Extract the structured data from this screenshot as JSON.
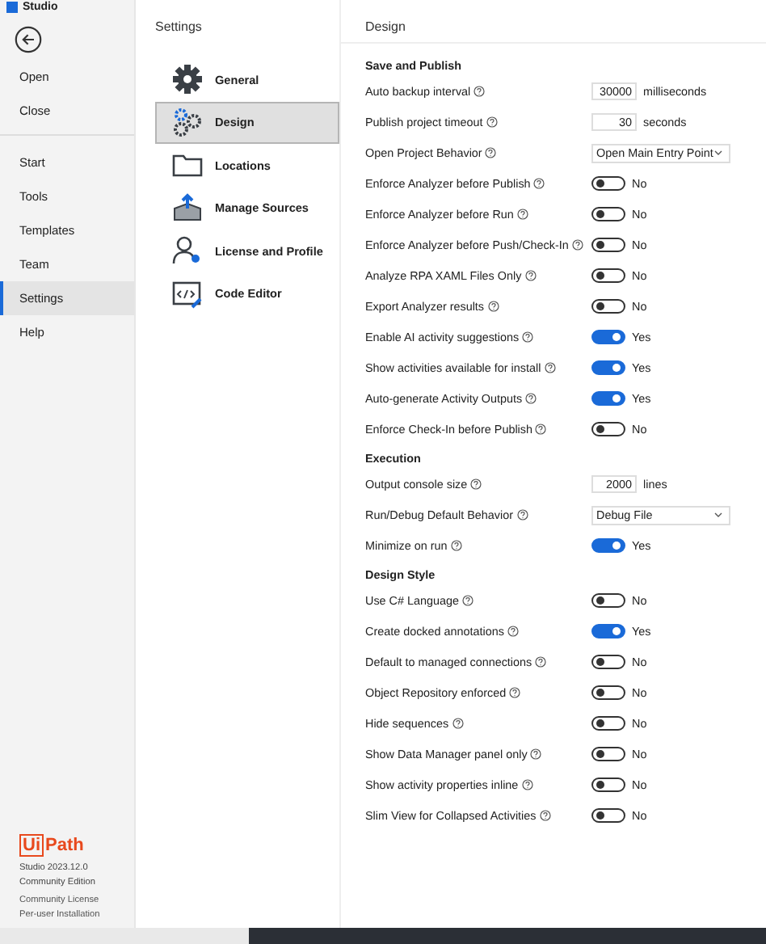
{
  "window": {
    "title": "Studio"
  },
  "sidebar": {
    "file_items": [
      {
        "label": "Open",
        "selected": false
      },
      {
        "label": "Close",
        "selected": false
      }
    ],
    "items": [
      {
        "label": "Start",
        "selected": false
      },
      {
        "label": "Tools",
        "selected": false
      },
      {
        "label": "Templates",
        "selected": false
      },
      {
        "label": "Team",
        "selected": false
      },
      {
        "label": "Settings",
        "selected": true
      },
      {
        "label": "Help",
        "selected": false
      }
    ],
    "logo": {
      "part_1": "Ui",
      "part_2": "Path"
    },
    "version": [
      "Studio 2023.12.0",
      "Community Edition"
    ],
    "license": [
      "Community License",
      "Per-user Installation"
    ]
  },
  "settings_nav": {
    "title": "Settings",
    "items": [
      {
        "label": "General",
        "kind": "gear",
        "selected": false
      },
      {
        "label": "Design",
        "kind": "gears",
        "selected": true
      },
      {
        "label": "Locations",
        "kind": "folder",
        "selected": false
      },
      {
        "label": "Manage Sources",
        "kind": "box",
        "selected": false
      },
      {
        "label": "License and Profile",
        "kind": "user",
        "selected": false
      },
      {
        "label": "Code Editor",
        "kind": "code",
        "selected": false
      }
    ]
  },
  "design": {
    "title": "Design",
    "sections": [
      {
        "title": "Save and Publish",
        "rows": [
          {
            "label": "Auto backup interval",
            "kind": "number",
            "value": "30000",
            "unit": "milliseconds"
          },
          {
            "label": "Publish project timeout",
            "kind": "number",
            "value": "30",
            "unit": "seconds"
          },
          {
            "label": "Open Project Behavior",
            "kind": "dropdown",
            "value": "Open Main Entry Point"
          },
          {
            "label": "Enforce Analyzer before Publish",
            "kind": "toggle",
            "on": false,
            "state_text": "No"
          },
          {
            "label": "Enforce Analyzer before Run",
            "kind": "toggle",
            "on": false,
            "state_text": "No"
          },
          {
            "label": "Enforce Analyzer before Push/Check-In",
            "kind": "toggle",
            "on": false,
            "state_text": "No"
          },
          {
            "label": "Analyze RPA XAML Files Only",
            "kind": "toggle",
            "on": false,
            "state_text": "No"
          },
          {
            "label": "Export Analyzer results",
            "kind": "toggle",
            "on": false,
            "state_text": "No"
          },
          {
            "label": "Enable AI activity suggestions",
            "kind": "toggle",
            "on": true,
            "state_text": "Yes"
          },
          {
            "label": "Show activities available for install",
            "kind": "toggle",
            "on": true,
            "state_text": "Yes"
          },
          {
            "label": "Auto-generate Activity Outputs",
            "kind": "toggle",
            "on": true,
            "state_text": "Yes"
          },
          {
            "label": "Enforce Check-In before Publish",
            "kind": "toggle",
            "on": false,
            "state_text": "No"
          }
        ]
      },
      {
        "title": "Execution",
        "rows": [
          {
            "label": "Output console size",
            "kind": "number",
            "value": "2000",
            "unit": "lines"
          },
          {
            "label": "Run/Debug Default Behavior",
            "kind": "dropdown",
            "value": "Debug File"
          },
          {
            "label": "Minimize on run",
            "kind": "toggle",
            "on": true,
            "state_text": "Yes"
          }
        ]
      },
      {
        "title": "Design Style",
        "rows": [
          {
            "label": "Use C# Language",
            "kind": "toggle",
            "on": false,
            "state_text": "No"
          },
          {
            "label": "Create docked annotations",
            "kind": "toggle",
            "on": true,
            "state_text": "Yes"
          },
          {
            "label": "Default to managed connections",
            "kind": "toggle",
            "on": false,
            "state_text": "No"
          },
          {
            "label": "Object Repository enforced",
            "kind": "toggle",
            "on": false,
            "state_text": "No"
          },
          {
            "label": "Hide sequences",
            "kind": "toggle",
            "on": false,
            "state_text": "No"
          },
          {
            "label": "Show Data Manager panel only",
            "kind": "toggle",
            "on": false,
            "state_text": "No"
          },
          {
            "label": "Show activity properties inline",
            "kind": "toggle",
            "on": false,
            "state_text": "No"
          },
          {
            "label": "Slim View for Collapsed Activities",
            "kind": "toggle",
            "on": false,
            "state_text": "No"
          }
        ]
      }
    ]
  }
}
